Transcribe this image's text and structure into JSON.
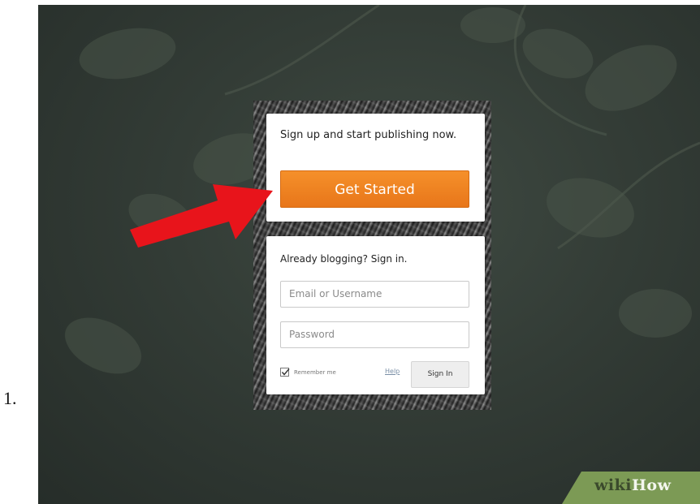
{
  "step": {
    "number": "1."
  },
  "signup": {
    "prompt": "Sign up and start publishing now.",
    "button_label": "Get Started"
  },
  "signin": {
    "heading": "Already blogging? Sign in.",
    "email_placeholder": "Email or Username",
    "password_placeholder": "Password",
    "remember_label": "Remember me",
    "remember_checked": true,
    "help_label": "Help",
    "button_label": "Sign In"
  },
  "annotation": {
    "icon": "red-arrow-icon",
    "color": "#e8141b"
  },
  "watermark": {
    "part1": "wiki",
    "part2": "How",
    "color": "#7c9a55"
  },
  "colors": {
    "accent": "#f08424",
    "background": "#333c36"
  }
}
